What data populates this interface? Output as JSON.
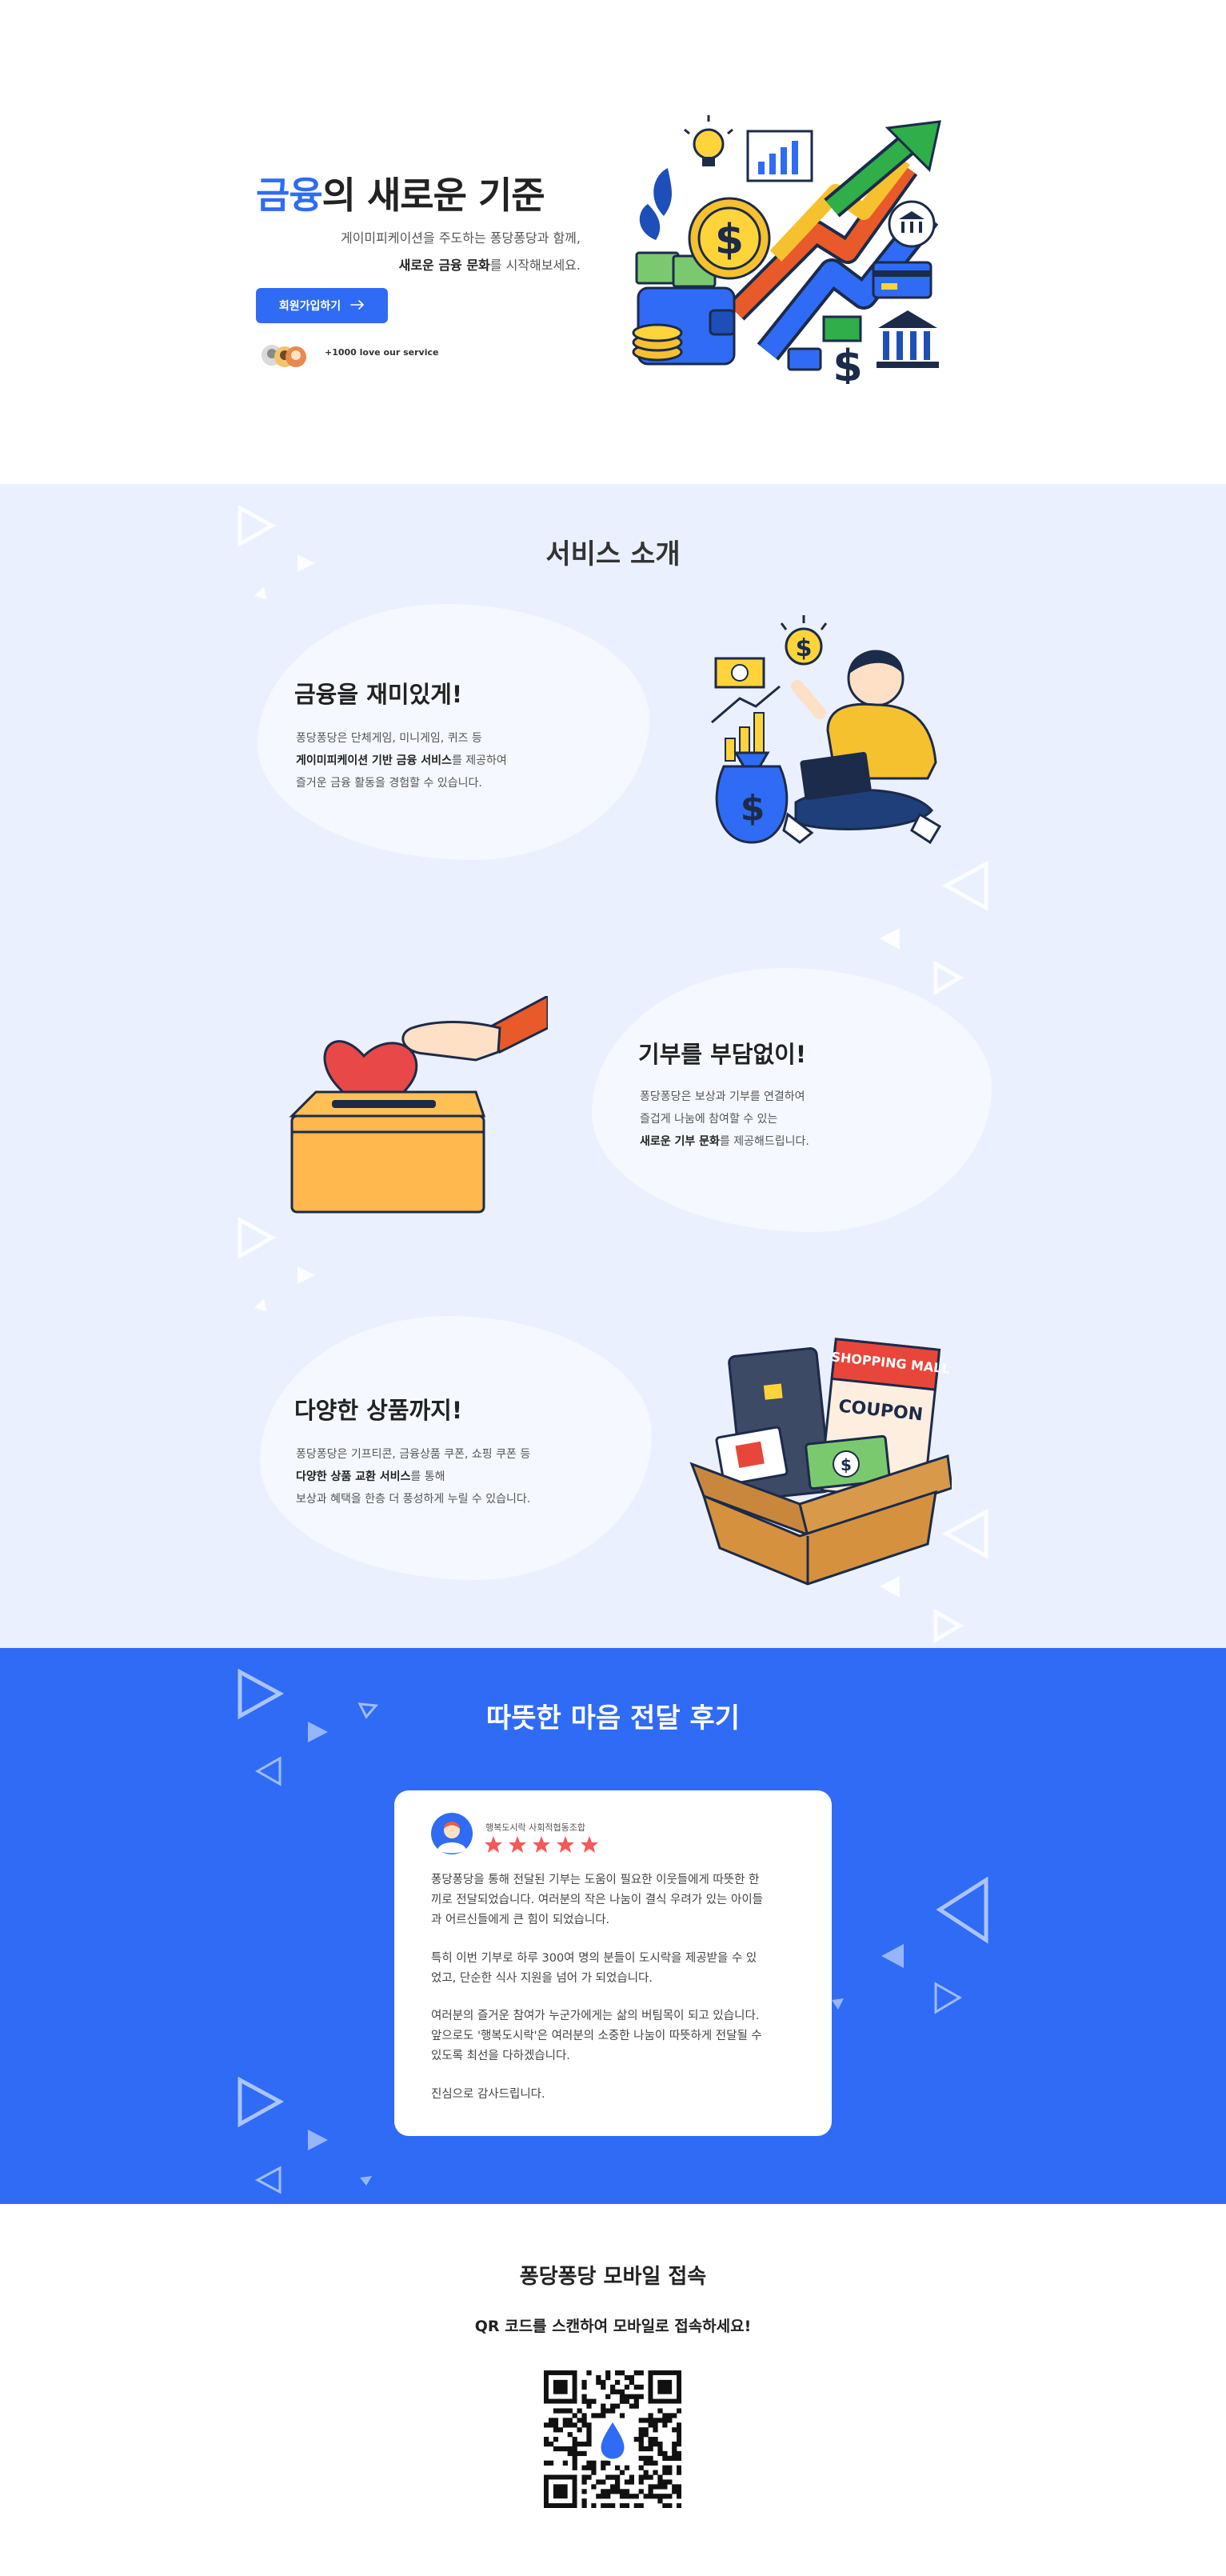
{
  "hero": {
    "title_accent": "금융",
    "title_rest": "의 새로운 기준",
    "desc_line1": "게이미피케이션을 주도하는 퐁당퐁당과 함께,",
    "desc_line2_bold": "새로운 금융 문화",
    "desc_line2_rest": "를 시작해보세요.",
    "signup_label": "회원가입하기",
    "love_text": "+1000 love our service"
  },
  "services": {
    "title": "서비스 소개",
    "items": [
      {
        "title": "금융을 재미있게!",
        "line1": "퐁당퐁당은 단체게임, 미니게임, 퀴즈 등",
        "line2_bold": "게이미피케이션 기반 금융 서비스",
        "line2_rest": "를 제공하여",
        "line3": "즐거운 금융 활동을 경험할 수 있습니다."
      },
      {
        "title": "기부를 부담없이!",
        "line1": "퐁당퐁당은 보상과 기부를 연결하여",
        "line2": "즐겁게 나눔에 참여할 수 있는",
        "line3_bold": "새로운 기부 문화",
        "line3_rest": "를 제공해드립니다."
      },
      {
        "title": "다양한 상품까지!",
        "line1": "퐁당퐁당은 기프티콘, 금융상품 쿠폰, 쇼핑 쿠폰 등",
        "line2_bold": "다양한 상품 교환 서비스",
        "line2_rest": "를 통해",
        "line3": "보상과 혜택을 한층 더 풍성하게 누릴 수 있습니다."
      }
    ],
    "shopping_mall_label": "SHOPPING MALL",
    "coupon_label": "COUPON"
  },
  "reviews": {
    "title": "따뜻한 마음 전달 후기",
    "reviewer": "행복도시락 사회적협동조합",
    "rating": 5,
    "lines": [
      "퐁당퐁당을 통해 전달된 기부는 도움이 필요한 이웃들에게 따뜻한 한",
      "끼로 전달되었습니다. 여러분의 작은 나눔이 결식 우려가 있는 아이들",
      "과 어르신들에게 큰 힘이 되었습니다.",
      "특히 이번 기부로 하루 300여 명의 분들이 도시락을 제공받을 수 있",
      "었고, 단순한 식사 지원을 넘어 가 되었습니다.",
      "여러분의 즐거운 참여가 누군가에게는 삶의 버팀목이 되고 있습니다.",
      "앞으로도 '행복도시락'은 여러분의 소중한 나눔이 따뜻하게 전달될 수",
      "있도록 최선을 다하겠습니다.",
      "진심으로 감사드립니다."
    ]
  },
  "mobile": {
    "title": "퐁당퐁당 모바일 접속",
    "subtitle": "QR 코드를 스캔하여 모바일로 접속하세요!"
  },
  "colors": {
    "accent": "#2f6bf5",
    "services_bg": "#ebf0fe",
    "star": "#f05a5a"
  }
}
